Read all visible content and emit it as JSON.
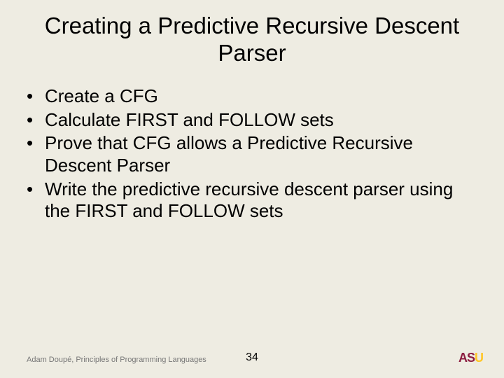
{
  "title": "Creating a Predictive Recursive Descent Parser",
  "bullets": [
    "Create a CFG",
    "Calculate FIRST and FOLLOW sets",
    "Prove that CFG allows a Predictive Recursive Descent Parser",
    "Write the predictive recursive descent parser using the FIRST and FOLLOW sets"
  ],
  "footer": {
    "credit": "Adam Doupé, Principles of Programming Languages",
    "page_number": "34",
    "logo_text_1": "AS",
    "logo_text_2": "U"
  }
}
